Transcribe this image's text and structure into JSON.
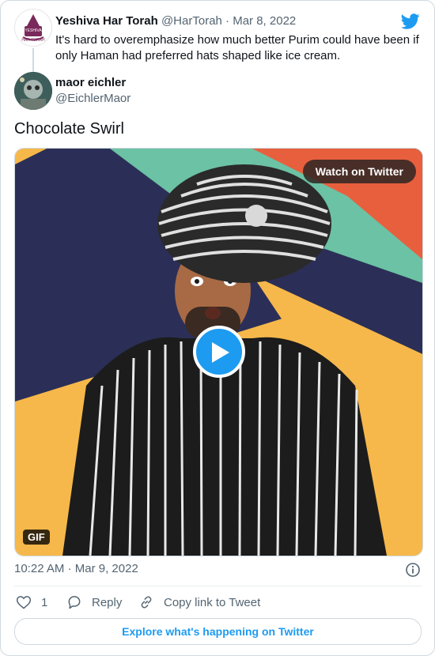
{
  "parent_tweet": {
    "name": "Yeshiva Har Torah",
    "handle": "@HarTorah",
    "separator": "·",
    "date": "Mar 8, 2022",
    "text": "It's hard to overemphasize how much better Purim could have been if only Haman had preferred hats shaped like ice cream.",
    "avatar_text_top": "YESHIVA",
    "avatar_text_bottom": "HAR TORAH"
  },
  "tweet": {
    "name": "maor eichler",
    "handle": "@EichlerMaor",
    "text": "Chocolate Swirl",
    "time": "10:22 AM",
    "separator": "·",
    "date": "Mar 9, 2022"
  },
  "media": {
    "watch_label": "Watch on Twitter",
    "gif_label": "GIF"
  },
  "actions": {
    "like_count": "1",
    "reply_label": "Reply",
    "copy_label": "Copy link to Tweet"
  },
  "explore_label": "Explore what's happening on Twitter",
  "colors": {
    "accent": "#1d9bf0",
    "stripe_navy": "#2b2f57",
    "stripe_green": "#6bc2a4",
    "stripe_orange": "#e85f3e",
    "stripe_yellow": "#f6b84a"
  },
  "icons": [
    "twitter-bird-icon",
    "play-icon",
    "info-icon",
    "heart-icon",
    "reply-icon",
    "link-icon"
  ]
}
